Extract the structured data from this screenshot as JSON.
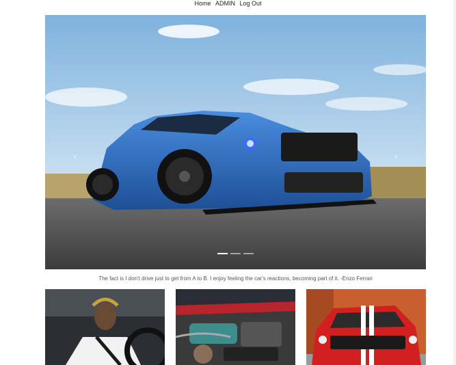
{
  "nav": {
    "home": "Home",
    "admin": "ADMIN",
    "logout": "Log Out"
  },
  "carousel": {
    "slide_count": 3,
    "active_index": 0,
    "prev_icon": "chevron-left-icon",
    "next_icon": "chevron-right-icon"
  },
  "quote": "The fact is I don't drive just to get from A to B. I enjoy feeling the car's reactions, becoming part of it. -Enzo Ferrari",
  "gallery": [
    {
      "subject": "driver at steering wheel"
    },
    {
      "subject": "engine bay"
    },
    {
      "subject": "red shelby mustang"
    }
  ],
  "colors": {
    "car_blue": "#2f6fc0",
    "sky": "#9cc3e3",
    "road": "#5b5b5b",
    "mustang_red": "#d21f1f"
  }
}
